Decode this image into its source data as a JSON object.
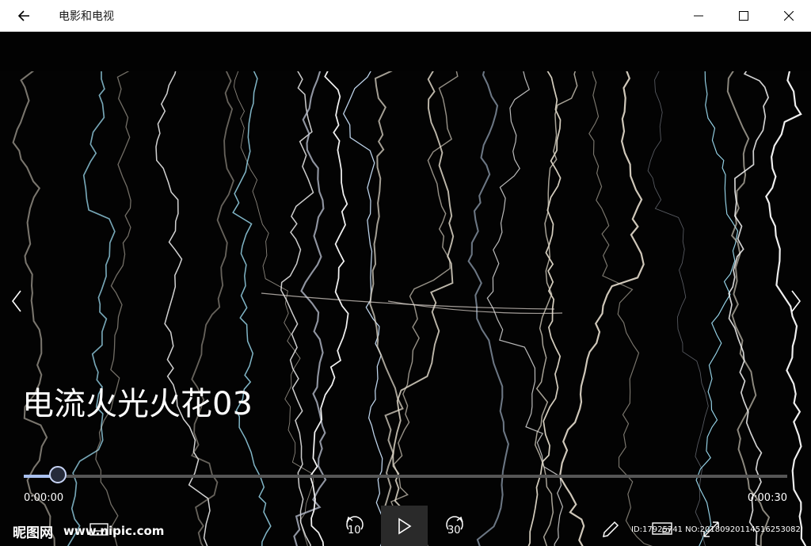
{
  "titlebar": {
    "app_title": "电影和电视",
    "back_icon": "back-arrow-icon",
    "minimize_icon": "minimize-icon",
    "maximize_icon": "maximize-icon",
    "close_icon": "close-icon"
  },
  "video": {
    "title": "电流火光火花03",
    "progress": 0.045,
    "current_time": "0:00:00",
    "total_time": "0:00:30"
  },
  "controls": {
    "skip_back_seconds": "10",
    "skip_forward_seconds": "30",
    "play_icon": "play-icon",
    "edit_icon": "pencil-icon",
    "resize_icon": "resize-icon",
    "subtitle_icon": "subtitles-icon",
    "cast_icon": "cast-icon"
  },
  "watermark": {
    "logo_text": "昵图网",
    "site": "www.nipic.com",
    "id_text": "ID:17925741 NO:20180920114516253082"
  },
  "colors": {
    "titlebar_bg": "#ffffff",
    "video_bg": "#020202",
    "seek_fill": "#a9c0ef",
    "seek_track": "#555555"
  }
}
